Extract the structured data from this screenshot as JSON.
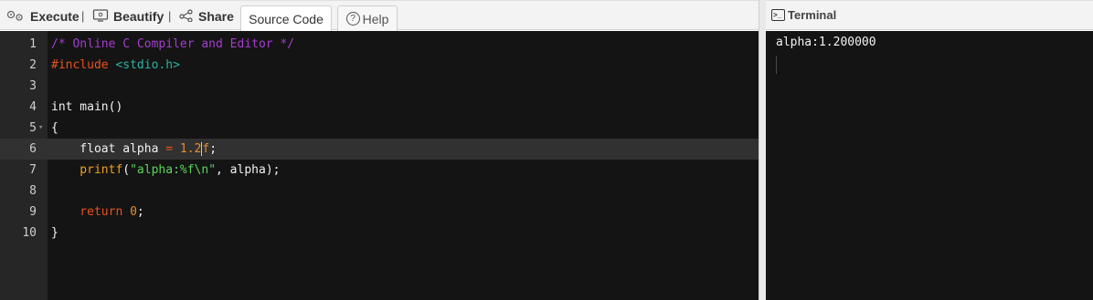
{
  "toolbar": {
    "execute_label": "Execute",
    "beautify_label": "Beautify",
    "share_label": "Share",
    "separator": "|",
    "tabs": [
      {
        "label": "Source Code",
        "active": true
      },
      {
        "label": "Help",
        "active": false
      }
    ]
  },
  "editor": {
    "active_line": 6,
    "lines": [
      {
        "num": "1",
        "tokens": [
          {
            "t": "/* Online C Compiler and Editor */",
            "c": "c-comment"
          }
        ]
      },
      {
        "num": "2",
        "tokens": [
          {
            "t": "#include ",
            "c": "c-include"
          },
          {
            "t": "<stdio.h>",
            "c": "c-header"
          }
        ]
      },
      {
        "num": "3",
        "tokens": []
      },
      {
        "num": "4",
        "tokens": [
          {
            "t": "int main()",
            "c": ""
          }
        ]
      },
      {
        "num": "5",
        "tokens": [
          {
            "t": "{",
            "c": ""
          }
        ],
        "fold": true
      },
      {
        "num": "6",
        "tokens": [
          {
            "t": "    float alpha ",
            "c": ""
          },
          {
            "t": "=",
            "c": "c-op"
          },
          {
            "t": " 1.2",
            "c": "c-num"
          },
          {
            "t": "|",
            "c": "cursor"
          },
          {
            "t": "f",
            "c": "c-num"
          },
          {
            "t": ";",
            "c": ""
          }
        ]
      },
      {
        "num": "7",
        "tokens": [
          {
            "t": "    printf",
            "c": "c-fn"
          },
          {
            "t": "(",
            "c": ""
          },
          {
            "t": "\"alpha:%f\\n\"",
            "c": "c-str"
          },
          {
            "t": ", alpha);",
            "c": ""
          }
        ]
      },
      {
        "num": "8",
        "tokens": []
      },
      {
        "num": "9",
        "tokens": [
          {
            "t": "    return ",
            "c": "c-ret"
          },
          {
            "t": "0",
            "c": "c-num"
          },
          {
            "t": ";",
            "c": ""
          }
        ]
      },
      {
        "num": "10",
        "tokens": [
          {
            "t": "}",
            "c": ""
          }
        ]
      }
    ]
  },
  "terminal": {
    "title": "Terminal",
    "icon_text": ">_",
    "output": "alpha:1.200000"
  },
  "icons": {
    "execute": "gears-icon",
    "beautify": "monitor-icon",
    "share": "share-icon",
    "help": "help-circle-icon",
    "terminal": "terminal-icon"
  }
}
